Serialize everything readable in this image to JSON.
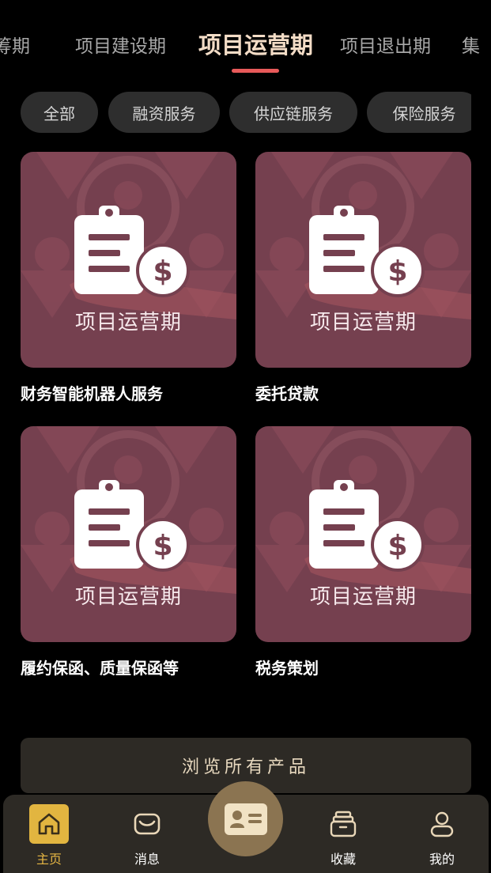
{
  "tabs": [
    {
      "label": "筹期",
      "active": false
    },
    {
      "label": "项目建设期",
      "active": false
    },
    {
      "label": "项目运营期",
      "active": true
    },
    {
      "label": "项目退出期",
      "active": false
    },
    {
      "label": "集",
      "active": false
    }
  ],
  "filters": [
    {
      "label": "全部"
    },
    {
      "label": "融资服务"
    },
    {
      "label": "供应链服务"
    },
    {
      "label": "保险服务"
    }
  ],
  "products": [
    {
      "title": "财务智能机器人服务",
      "image_caption": "项目运营期",
      "icon": "invoice-dollar-icon"
    },
    {
      "title": "委托贷款",
      "image_caption": "项目运营期",
      "icon": "invoice-dollar-icon"
    },
    {
      "title": "履约保函、质量保函等",
      "image_caption": "项目运营期",
      "icon": "invoice-dollar-icon"
    },
    {
      "title": "税务策划",
      "image_caption": "项目运营期",
      "icon": "invoice-dollar-icon"
    }
  ],
  "browse_button": "浏览所有产品",
  "bottom_nav": [
    {
      "label": "主页",
      "icon": "home-icon",
      "active": true
    },
    {
      "label": "消息",
      "icon": "message-icon",
      "active": false
    },
    {
      "label": "",
      "icon": "id-card-icon",
      "active": false
    },
    {
      "label": "收藏",
      "icon": "archive-box-icon",
      "active": false
    },
    {
      "label": "我的",
      "icon": "user-icon",
      "active": false
    }
  ],
  "colors": {
    "background": "#000000",
    "accent": "#e85a5a",
    "active_tab": "#f3dcc6",
    "nav_active": "#e2b540",
    "card_bg": "#75404f",
    "center_button": "#8b7451"
  }
}
